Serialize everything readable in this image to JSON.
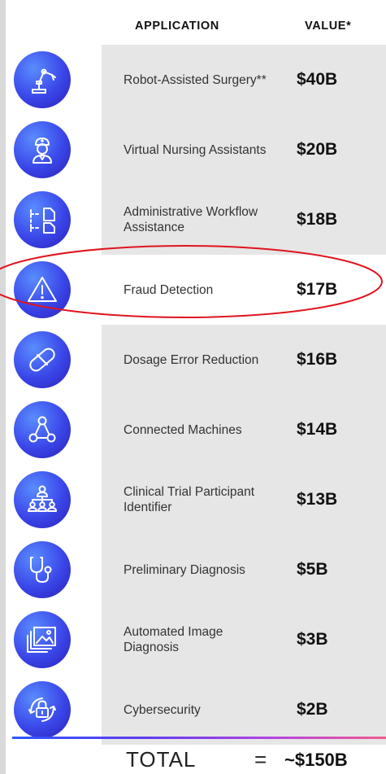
{
  "header": {
    "application": "APPLICATION",
    "value": "VALUE*"
  },
  "chart_data": {
    "type": "table",
    "columns": [
      "APPLICATION",
      "VALUE*"
    ],
    "rows": [
      {
        "application": "Robot-Assisted Surgery**",
        "value": "$40B",
        "amount_billion": 40,
        "icon": "robot-arm-icon"
      },
      {
        "application": "Virtual Nursing Assistants",
        "value": "$20B",
        "amount_billion": 20,
        "icon": "nurse-icon"
      },
      {
        "application": "Administrative Workflow Assistance",
        "value": "$18B",
        "amount_billion": 18,
        "icon": "workflow-icon"
      },
      {
        "application": "Fraud Detection",
        "value": "$17B",
        "amount_billion": 17,
        "icon": "warning-icon"
      },
      {
        "application": "Dosage Error Reduction",
        "value": "$16B",
        "amount_billion": 16,
        "icon": "pill-icon"
      },
      {
        "application": "Connected Machines",
        "value": "$14B",
        "amount_billion": 14,
        "icon": "network-icon"
      },
      {
        "application": "Clinical Trial Participant Identifier",
        "value": "$13B",
        "amount_billion": 13,
        "icon": "people-hierarchy-icon"
      },
      {
        "application": "Preliminary Diagnosis",
        "value": "$5B",
        "amount_billion": 5,
        "icon": "stethoscope-icon"
      },
      {
        "application": "Automated Image Diagnosis",
        "value": "$3B",
        "amount_billion": 3,
        "icon": "image-stack-icon"
      },
      {
        "application": "Cybersecurity",
        "value": "$2B",
        "amount_billion": 2,
        "icon": "lock-cycle-icon"
      }
    ],
    "total": {
      "label": "TOTAL",
      "equals": "=",
      "value": "~$150B"
    },
    "highlighted_row": "Fraud Detection"
  },
  "colors": {
    "icon_circle": "#3a46e8",
    "row_band": "#e6e6e6",
    "highlight_ellipse": "#e0141e",
    "divider_start": "#2f57ff",
    "divider_end": "#f25b8f"
  }
}
